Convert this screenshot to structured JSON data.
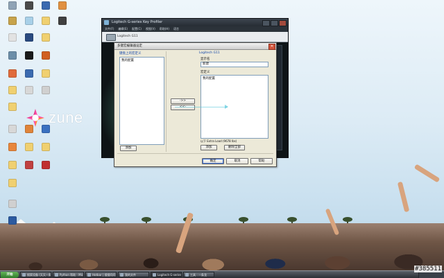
{
  "desktop": {
    "brand": {
      "name": "zune"
    },
    "icons": [
      {
        "label": "",
        "color": "#8fa3b5"
      },
      {
        "label": "",
        "color": "#c7a34b"
      },
      {
        "label": "",
        "color": "#e2e2e2"
      },
      {
        "label": "",
        "color": "#6c8ea8"
      },
      {
        "label": "",
        "color": "#e06b3b"
      },
      {
        "label": "",
        "color": "#f0d070"
      },
      {
        "label": "",
        "color": "#f0d070"
      },
      {
        "label": "",
        "color": "#d8d8d8"
      },
      {
        "label": "",
        "color": "#e8863c"
      },
      {
        "label": "",
        "color": "#f0d070"
      },
      {
        "label": "",
        "color": "#f0d070"
      },
      {
        "label": "",
        "color": "#d0d0d0"
      },
      {
        "label": "",
        "color": "#2c5aa0"
      },
      {
        "label": "",
        "color": "#4a4a4a"
      },
      {
        "label": "",
        "color": "#a8d0e8"
      },
      {
        "label": "",
        "color": "#2a4a80"
      },
      {
        "label": "",
        "color": "#1a1a1a"
      },
      {
        "label": "",
        "color": "#3a6ab0"
      },
      {
        "label": "",
        "color": "#d8d8d8"
      },
      {
        "label": "",
        "color": "#e0843a"
      },
      {
        "label": "",
        "color": "#f0d070"
      },
      {
        "label": "",
        "color": "#c04040"
      },
      {
        "label": "",
        "color": "#3a6ab0"
      },
      {
        "label": "",
        "color": "#f0d070"
      },
      {
        "label": "",
        "color": "#f0d070"
      },
      {
        "label": "",
        "color": "#d06020"
      },
      {
        "label": "",
        "color": "#f0d070"
      },
      {
        "label": "",
        "color": "#d0d0d0"
      },
      {
        "label": "",
        "color": "#3a70c0"
      },
      {
        "label": "",
        "color": "#f0d070"
      },
      {
        "label": "",
        "color": "#c03030"
      },
      {
        "label": "",
        "color": "#e09040"
      },
      {
        "label": "",
        "color": "#404040"
      }
    ]
  },
  "app_window": {
    "title": "Logitech G-series Key Profiler",
    "menu": [
      "文件(F)",
      "编辑(E)",
      "配置(C)",
      "视图(V)",
      "帮助(H)",
      "语言"
    ],
    "profile_name": "Logitech G11"
  },
  "dialog": {
    "title": "多键宏编辑器设定",
    "left_header": "键盘上的宏定义",
    "left_items": [
      "我的配置"
    ],
    "left_button": "添加",
    "move_right_button": "->>",
    "move_left_button": "<<-",
    "right_header": "Logitech G11",
    "name_label": "显示名",
    "name_value": "新建",
    "target_label": "宏定义",
    "right_items": [
      "我的配置"
    ],
    "hint": "以下 Extra Load (9678 lbs)",
    "add_button": "添加",
    "remove_button": "删除全部",
    "ok_button": "确定",
    "cancel_button": "取消",
    "help_button": "帮助"
  },
  "taskbar": {
    "start_label": "开始",
    "items": [
      {
        "label": "搜索设备 (天天一周…"
      },
      {
        "label": "Python 帮助 - Micro…"
      },
      {
        "label": "Hotbar | 搜搜问问…"
      },
      {
        "label": "我的文件"
      },
      {
        "label": "Logitech G-series Key…"
      },
      {
        "label": "工具 - 一条龙"
      }
    ]
  },
  "watermark": "#385511"
}
